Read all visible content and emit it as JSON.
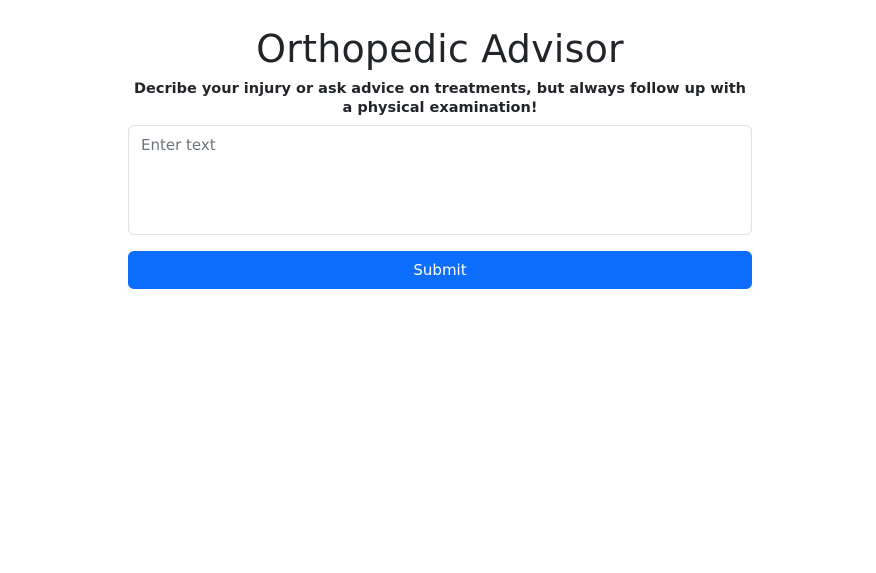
{
  "header": {
    "title": "Orthopedic Advisor",
    "subtitle": "Decribe your injury or ask advice on treatments, but always follow up with a physical examination!"
  },
  "form": {
    "input_value": "",
    "input_placeholder": "Enter text",
    "submit_label": "Submit"
  },
  "colors": {
    "primary": "#0d6efd",
    "text": "#212529",
    "placeholder": "#6c757d",
    "border": "#dee2e6",
    "background": "#ffffff"
  }
}
